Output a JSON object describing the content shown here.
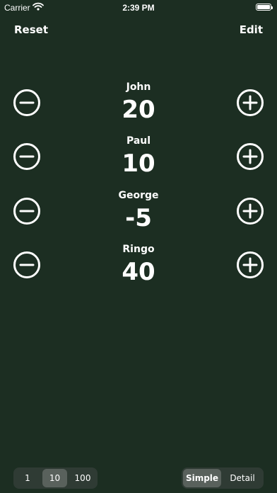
{
  "status": {
    "carrier": "Carrier",
    "time": "2:39 PM"
  },
  "nav": {
    "reset": "Reset",
    "edit": "Edit"
  },
  "players": [
    {
      "name": "John",
      "score": "20"
    },
    {
      "name": "Paul",
      "score": "10"
    },
    {
      "name": "George",
      "score": "-5"
    },
    {
      "name": "Ringo",
      "score": "40"
    }
  ],
  "increment": {
    "options": [
      "1",
      "10",
      "100"
    ],
    "selected": "10"
  },
  "view_mode": {
    "options": [
      "Simple",
      "Detail"
    ],
    "selected": "Simple"
  },
  "colors": {
    "background": "#1c2e22",
    "segment_bg": "#2f3b34",
    "segment_selected": "#59615c"
  },
  "icons": {
    "minus": "minus-circle-icon",
    "plus": "plus-circle-icon"
  }
}
